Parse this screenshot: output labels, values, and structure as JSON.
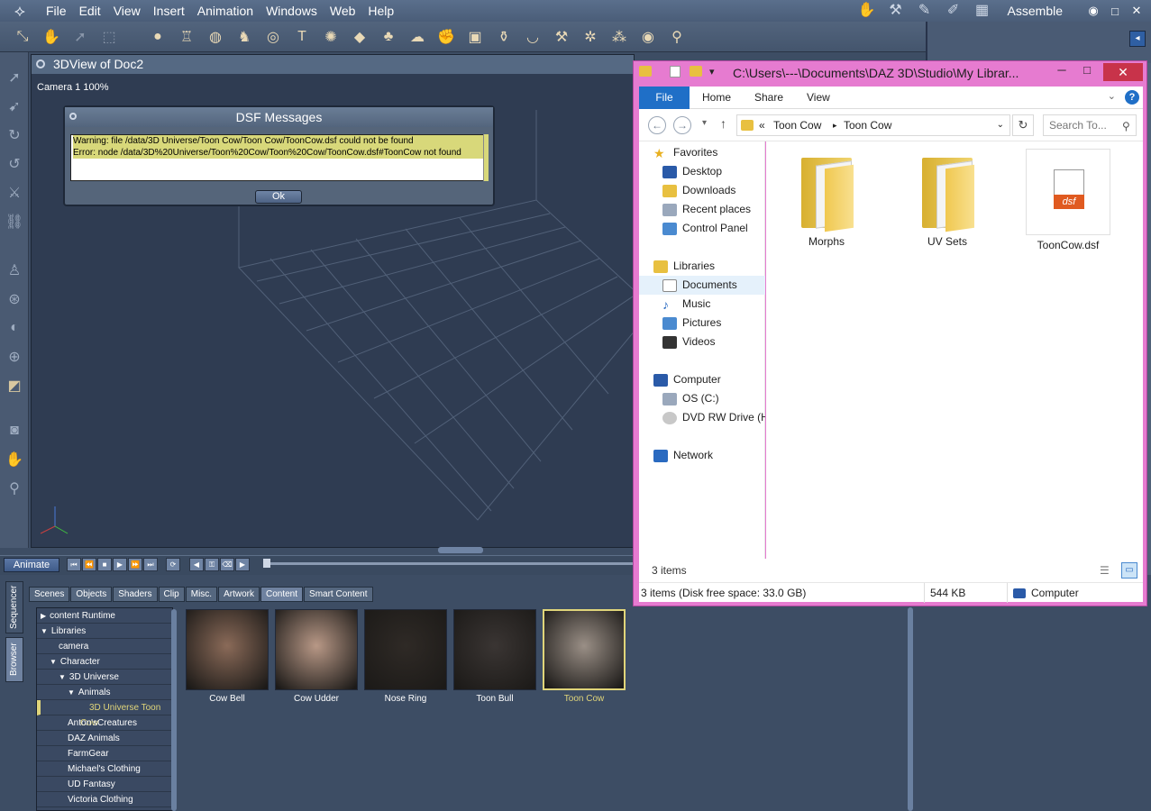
{
  "menubar": {
    "items": [
      "File",
      "Edit",
      "View",
      "Insert",
      "Animation",
      "Windows",
      "Web",
      "Help"
    ],
    "assemble_label": "Assemble"
  },
  "viewport": {
    "title": "3DView of Doc2",
    "camera_label": "Camera 1 100%"
  },
  "dialog": {
    "title": "DSF Messages",
    "warning": "Warning: file /data/3D Universe/Toon Cow/Toon Cow/ToonCow.dsf could not be found",
    "error": "Error: node /data/3D%20Universe/Toon%20Cow/Toon%20Cow/ToonCow.dsf#ToonCow not found",
    "ok_label": "Ok"
  },
  "timeline": {
    "animate_label": "Animate"
  },
  "sidetabs": [
    "Sequencer",
    "Browser"
  ],
  "content_tabs": [
    "Scenes",
    "Objects",
    "Shaders",
    "Clip",
    "Misc.",
    "Artwork",
    "Content",
    "Smart Content"
  ],
  "active_tab": "Content",
  "tree": [
    {
      "label": "content Runtime",
      "indent": 0,
      "arrow": "▶"
    },
    {
      "label": "Libraries",
      "indent": 0,
      "arrow": "▼"
    },
    {
      "label": "camera",
      "indent": 1,
      "arrow": ""
    },
    {
      "label": "Character",
      "indent": 1,
      "arrow": "▼"
    },
    {
      "label": "3D Universe",
      "indent": 2,
      "arrow": "▼"
    },
    {
      "label": "Animals",
      "indent": 3,
      "arrow": "▼"
    },
    {
      "label": "3D Universe Toon Cow",
      "indent": 4,
      "arrow": "",
      "selected": true
    },
    {
      "label": "Anton'sCreatures",
      "indent": 2,
      "arrow": ""
    },
    {
      "label": "DAZ Animals",
      "indent": 2,
      "arrow": ""
    },
    {
      "label": "FarmGear",
      "indent": 2,
      "arrow": ""
    },
    {
      "label": "Michael's Clothing",
      "indent": 2,
      "arrow": ""
    },
    {
      "label": "UD Fantasy",
      "indent": 2,
      "arrow": ""
    },
    {
      "label": "Victoria Clothing",
      "indent": 2,
      "arrow": ""
    }
  ],
  "thumbnails": [
    {
      "label": "Cow Bell",
      "color": "#8a6a58"
    },
    {
      "label": "Cow Udder",
      "color": "#b89886"
    },
    {
      "label": "Nose Ring",
      "color": "#2f2a26"
    },
    {
      "label": "Toon Bull",
      "color": "#3a3533"
    },
    {
      "label": "Toon Cow",
      "color": "#9a8f86",
      "selected": true
    }
  ],
  "explorer": {
    "title_path": "C:\\Users\\---\\Documents\\DAZ 3D\\Studio\\My Librar...",
    "ribbon_tabs": [
      "File",
      "Home",
      "Share",
      "View"
    ],
    "address_prefix": "«",
    "address_crumbs": [
      "Toon Cow",
      "Toon Cow"
    ],
    "search_placeholder": "Search To...",
    "nav": {
      "favorites": "Favorites",
      "favorites_items": [
        "Desktop",
        "Downloads",
        "Recent places",
        "Control Panel"
      ],
      "libraries": "Libraries",
      "libraries_items": [
        "Documents",
        "Music",
        "Pictures",
        "Videos"
      ],
      "computer": "Computer",
      "computer_items": [
        "OS (C:)",
        "DVD RW Drive (H"
      ],
      "network": "Network"
    },
    "items": [
      {
        "name": "Morphs",
        "type": "folder"
      },
      {
        "name": "UV Sets",
        "type": "folder"
      },
      {
        "name": "ToonCow.dsf",
        "type": "file",
        "ext": "dsf"
      }
    ],
    "status_count": "3 items",
    "detail_left": "3 items (Disk free space: 33.0 GB)",
    "detail_size": "544 KB",
    "detail_right": "Computer"
  }
}
